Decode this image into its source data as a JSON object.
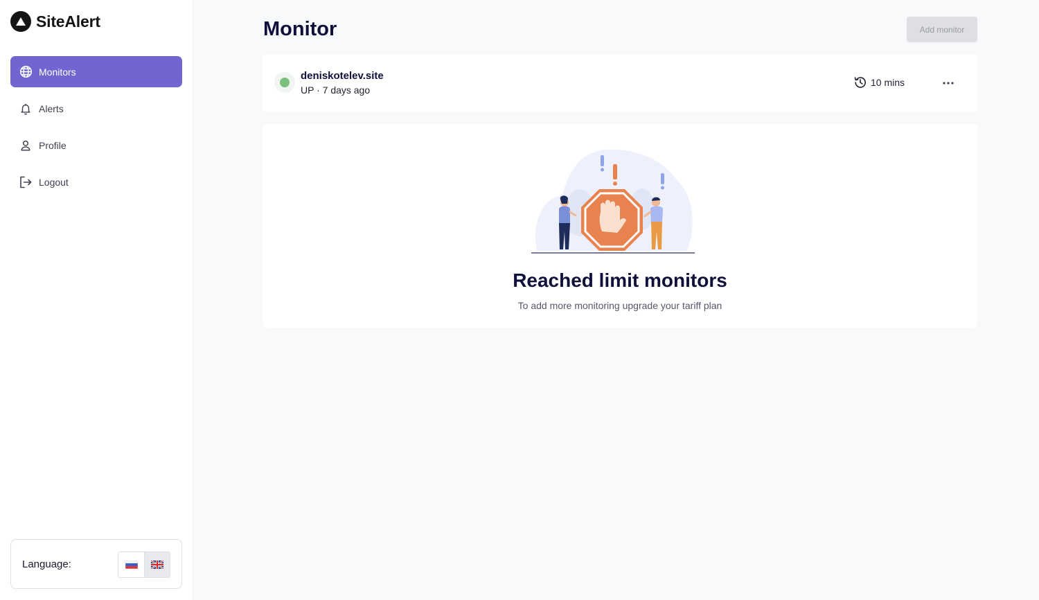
{
  "brand": {
    "name": "SiteAlert"
  },
  "sidebar": {
    "items": [
      {
        "label": "Monitors",
        "icon": "globe-icon",
        "active": true
      },
      {
        "label": "Alerts",
        "icon": "bell-icon",
        "active": false
      },
      {
        "label": "Profile",
        "icon": "user-icon",
        "active": false
      },
      {
        "label": "Logout",
        "icon": "logout-icon",
        "active": false
      }
    ],
    "language": {
      "label": "Language:",
      "options": [
        {
          "code": "ru",
          "icon": "russia-flag-icon",
          "selected": false
        },
        {
          "code": "en",
          "icon": "uk-flag-icon",
          "selected": true
        }
      ]
    }
  },
  "main": {
    "title": "Monitor",
    "add_button_label": "Add monitor",
    "monitor": {
      "site": "deniskotelev.site",
      "status_text": "UP · 7 days ago",
      "status_color": "#7cc07f",
      "interval": "10 mins"
    },
    "limit": {
      "title": "Reached limit monitors",
      "subtitle": "To add more monitoring upgrade your tariff plan"
    }
  },
  "colors": {
    "accent": "#7166d1",
    "illustration_orange": "#e8834f"
  }
}
